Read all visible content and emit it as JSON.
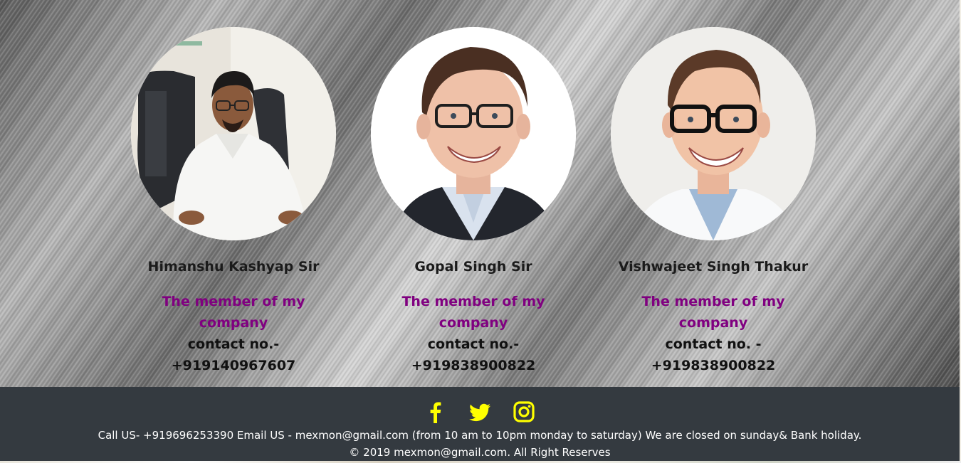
{
  "team": {
    "members": [
      {
        "name": "Himanshu Kashyap Sir",
        "role": "The member of my company",
        "contact_label": "contact no.-",
        "phone": "+919140967607"
      },
      {
        "name": "Gopal Singh Sir",
        "role": "The member of my company",
        "contact_label": "contact no.-",
        "phone": "+919838900822"
      },
      {
        "name": "Vishwajeet Singh Thakur",
        "role": "The member of my company",
        "contact_label": "contact no. -",
        "phone": "+919838900822"
      }
    ]
  },
  "footer": {
    "social": [
      "facebook-icon",
      "twitter-icon",
      "instagram-icon"
    ],
    "icon_color": "#ffff00",
    "contact_text": "Call US- +919696253390 Email US - mexmon@gmail.com (from 10 am to 10pm monday to saturday) We are closed on sunday& Bank holiday.",
    "copyright": "© 2019 mexmon@gmail.com. All Right Reserves"
  },
  "colors": {
    "role_text": "#800080",
    "footer_bg": "#343a40"
  }
}
